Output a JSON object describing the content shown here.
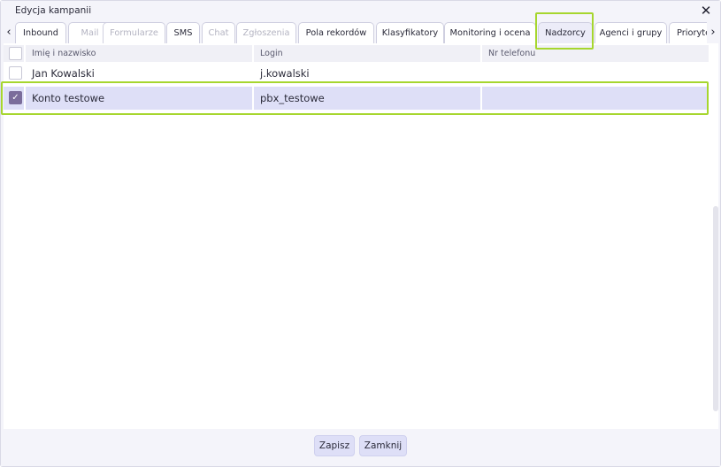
{
  "window": {
    "title": "Edycja kampanii",
    "close_glyph": "✕"
  },
  "tabs": {
    "prev_glyph": "‹",
    "next_glyph": "›",
    "items": [
      {
        "label": "Inbound",
        "state": "normal"
      },
      {
        "label": "Mail",
        "state": "disabled"
      },
      {
        "label": "Formularze",
        "state": "disabled"
      },
      {
        "label": "SMS",
        "state": "normal"
      },
      {
        "label": "Chat",
        "state": "disabled"
      },
      {
        "label": "Zgłoszenia",
        "state": "disabled"
      },
      {
        "label": "Pola rekordów",
        "state": "normal"
      },
      {
        "label": "Klasyfikatory",
        "state": "normal"
      },
      {
        "label": "Monitoring i ocena",
        "state": "normal"
      },
      {
        "label": "Nadzorcy",
        "state": "active"
      },
      {
        "label": "Agenci i grupy",
        "state": "normal"
      },
      {
        "label": "Prioryte",
        "state": "normal"
      }
    ]
  },
  "table": {
    "columns": [
      "Imię i nazwisko",
      "Login",
      "Nr telefonu"
    ],
    "rows": [
      {
        "name": "Jan Kowalski",
        "login": "j.kowalski",
        "phone": "",
        "checked": false
      },
      {
        "name": "Konto testowe",
        "login": "pbx_testowe",
        "phone": "",
        "checked": true
      }
    ]
  },
  "footer": {
    "save_label": "Zapisz",
    "close_label": "Zamknij"
  },
  "colors": {
    "highlight": "#a6d62e",
    "selected_row": "#dedff7",
    "checkbox_checked": "#7b6d9b",
    "button": "#dedff7"
  }
}
